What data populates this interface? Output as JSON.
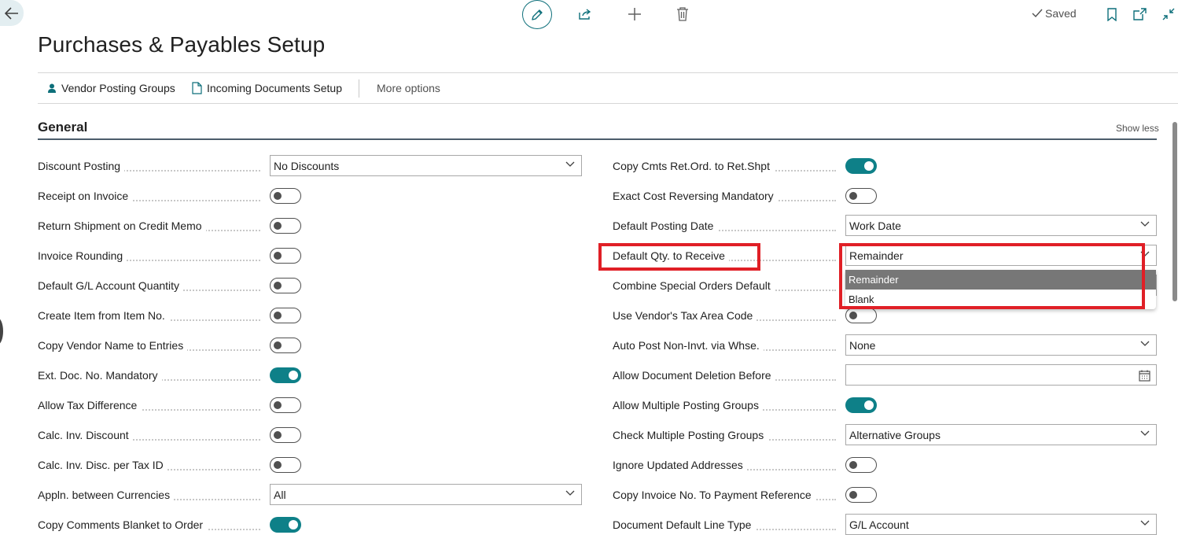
{
  "header": {
    "title": "Purchases & Payables Setup",
    "saved_label": "Saved"
  },
  "actions": {
    "vendor_posting_groups": "Vendor Posting Groups",
    "incoming_documents_setup": "Incoming Documents Setup",
    "more_options": "More options"
  },
  "section": {
    "title": "General",
    "show_less": "Show less"
  },
  "left_fields": [
    {
      "label": "Discount Posting",
      "type": "select",
      "value": "No Discounts"
    },
    {
      "label": "Receipt on Invoice",
      "type": "toggle",
      "on": false
    },
    {
      "label": "Return Shipment on Credit Memo",
      "type": "toggle",
      "on": false
    },
    {
      "label": "Invoice Rounding",
      "type": "toggle",
      "on": false
    },
    {
      "label": "Default G/L Account Quantity",
      "type": "toggle",
      "on": false
    },
    {
      "label": "Create Item from Item No.",
      "type": "toggle",
      "on": false
    },
    {
      "label": "Copy Vendor Name to Entries",
      "type": "toggle",
      "on": false
    },
    {
      "label": "Ext. Doc. No. Mandatory",
      "type": "toggle",
      "on": true
    },
    {
      "label": "Allow Tax Difference",
      "type": "toggle",
      "on": false
    },
    {
      "label": "Calc. Inv. Discount",
      "type": "toggle",
      "on": false
    },
    {
      "label": "Calc. Inv. Disc. per Tax ID",
      "type": "toggle",
      "on": false
    },
    {
      "label": "Appln. between Currencies",
      "type": "select",
      "value": "All"
    },
    {
      "label": "Copy Comments Blanket to Order",
      "type": "toggle",
      "on": true
    }
  ],
  "right_fields": [
    {
      "label": "Copy Cmts Ret.Ord. to Ret.Shpt",
      "type": "toggle",
      "on": true
    },
    {
      "label": "Exact Cost Reversing Mandatory",
      "type": "toggle",
      "on": false
    },
    {
      "label": "Default Posting Date",
      "type": "select",
      "value": "Work Date"
    },
    {
      "label": "Default Qty. to Receive",
      "type": "select",
      "value": "Remainder"
    },
    {
      "label": "Combine Special Orders Default",
      "type": "select",
      "value": ""
    },
    {
      "label": "Use Vendor's Tax Area Code",
      "type": "toggle",
      "on": false
    },
    {
      "label": "Auto Post Non-Invt. via Whse.",
      "type": "select",
      "value": "None"
    },
    {
      "label": "Allow Document Deletion Before",
      "type": "date",
      "value": ""
    },
    {
      "label": "Allow Multiple Posting Groups",
      "type": "toggle",
      "on": true
    },
    {
      "label": "Check Multiple Posting Groups",
      "type": "select",
      "value": "Alternative Groups"
    },
    {
      "label": "Ignore Updated Addresses",
      "type": "toggle",
      "on": false
    },
    {
      "label": "Copy Invoice No. To Payment Reference",
      "type": "toggle",
      "on": false
    },
    {
      "label": "Document Default Line Type",
      "type": "select",
      "value": "G/L Account"
    }
  ],
  "dropdown_options": [
    "Remainder",
    "Blank"
  ],
  "colors": {
    "accent": "#0e8088",
    "highlight": "#e01f26",
    "section_line": "#4b5d6b"
  },
  "icons": [
    "back-arrow-icon",
    "pencil-icon",
    "share-icon",
    "plus-icon",
    "trash-icon",
    "checkmark-icon",
    "bookmark-icon",
    "open-new-window-icon",
    "collapse-icon",
    "person-icon",
    "document-icon",
    "chevron-down-icon",
    "calendar-icon"
  ]
}
